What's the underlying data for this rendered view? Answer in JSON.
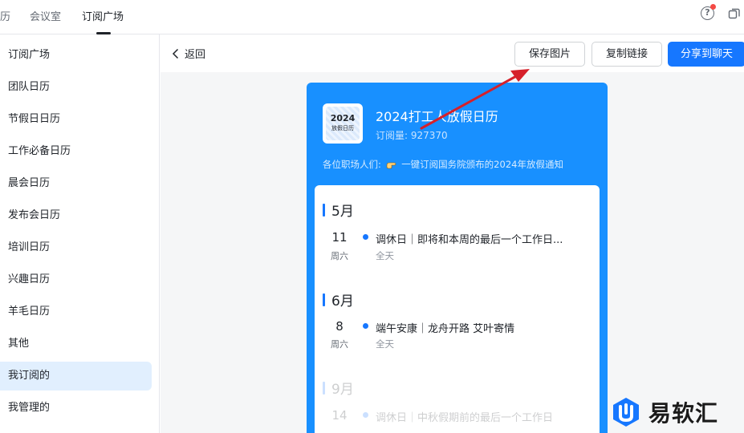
{
  "topbar": {
    "tabs": [
      {
        "label": "历"
      },
      {
        "label": "会议室"
      },
      {
        "label": "订阅广场"
      }
    ]
  },
  "sidebar": {
    "items": [
      {
        "label": "订阅广场"
      },
      {
        "label": "团队日历"
      },
      {
        "label": "节假日日历"
      },
      {
        "label": "工作必备日历"
      },
      {
        "label": "晨会日历"
      },
      {
        "label": "发布会日历"
      },
      {
        "label": "培训日历"
      },
      {
        "label": "兴趣日历"
      },
      {
        "label": "羊毛日历"
      },
      {
        "label": "其他"
      },
      {
        "label": "我订阅的"
      },
      {
        "label": "我管理的"
      }
    ],
    "selected_index": 10
  },
  "toolbar": {
    "back_label": "返回",
    "save_image_label": "保存图片",
    "copy_link_label": "复制链接",
    "share_label": "分享到聊天"
  },
  "calendar": {
    "logo_year": "2024",
    "logo_sub": "放假日历",
    "title": "2024打工人放假日历",
    "subscribers": "订阅量: 927370",
    "description_prefix": "各位职场人们:",
    "description_suffix": "一键订阅国务院颁布的2024年放假通知",
    "months": [
      {
        "label": "5月",
        "events": [
          {
            "day": "11",
            "weekday": "周六",
            "title": "调休日｜即将和本周的最后一个工作日...",
            "time": "全天"
          }
        ]
      },
      {
        "label": "6月",
        "events": [
          {
            "day": "8",
            "weekday": "周六",
            "title": "端午安康｜龙舟开路 艾叶寄情",
            "time": "全天"
          }
        ]
      },
      {
        "label": "9月",
        "events": [
          {
            "day": "14",
            "weekday": "",
            "title": "调休日｜中秋假期前的最后一个工作日",
            "time": ""
          }
        ]
      }
    ]
  },
  "watermark": {
    "text": "易软汇"
  },
  "colors": {
    "accent": "#1677ff",
    "card_blue": "#1890ff",
    "annotation_arrow": "#d6202a"
  }
}
